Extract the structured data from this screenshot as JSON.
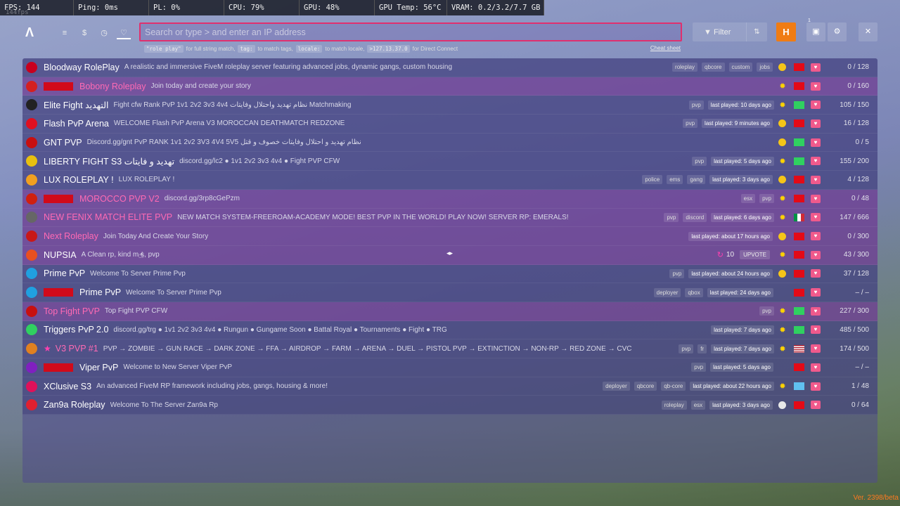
{
  "stats": [
    {
      "label": "FPS: 144"
    },
    {
      "label": "Ping: 0ms"
    },
    {
      "label": "PL: 0%"
    },
    {
      "label": "CPU: 79%"
    },
    {
      "label": "GPU: 48%"
    },
    {
      "label": "GPU Temp: 56°C"
    },
    {
      "label": "VRAM: 0.2/3.2/7.7 GB"
    }
  ],
  "fps_ghost": "144fps",
  "nav": {
    "logo": "Λ",
    "icons": [
      "list-icon",
      "dollar-icon",
      "history-icon",
      "heart-icon"
    ],
    "glyphs": [
      "≡",
      "$",
      "◷",
      "♡"
    ]
  },
  "search": {
    "placeholder": "Search or type > and enter an IP address"
  },
  "hint": {
    "code1": "\"role play\"",
    "t1": "for full string match,",
    "code2": "tag:",
    "t2": "to match tags,",
    "code3": "locale:",
    "t3": "to match locale,",
    "code4": ">127.13.37.0",
    "t4": "for Direct Connect",
    "cheat": "Cheat sheet"
  },
  "toolbar": {
    "filter_label": "Filter",
    "user_initial": "H",
    "notif_count": "1"
  },
  "servers": [
    {
      "name": "Bloodway RolePlay",
      "desc": "A realistic and immersive FiveM roleplay server featuring advanced jobs, dynamic gangs, custom housing",
      "tags": [
        "roleplay",
        "qbcore",
        "custom",
        "jobs"
      ],
      "last": "",
      "players": "0 / 128",
      "icon_color": "#c8001e",
      "red_tag": false,
      "pink": false,
      "boost": "y",
      "flag": "red",
      "alt": false
    },
    {
      "name": "Bobony Roleplay",
      "desc": "Join today and create your story",
      "tags": [],
      "last": "",
      "players": "0 / 160",
      "icon_color": "#d42020",
      "red_tag": true,
      "pink": true,
      "boost": "sun",
      "flag": "red",
      "alt": true
    },
    {
      "name": "Elite Fight التهديد",
      "desc": "Fight cfw Rank PvP 1v1 2v2 3v3 4v4 نظام تهديد واحتلال وفايتات Matchmaking",
      "tags": [
        "pvp"
      ],
      "last": "last played: 10 days ago",
      "players": "105 / 150",
      "icon_color": "#222",
      "red_tag": false,
      "pink": false,
      "boost": "sun",
      "flag": "green",
      "alt": false
    },
    {
      "name": "Flash PvP Arena",
      "desc": "WELCOME Flash PvP Arena V3 MOROCCAN DEATHMATCH REDZONE",
      "tags": [
        "pvp"
      ],
      "last": "last played: 9 minutes ago",
      "players": "16 / 128",
      "icon_color": "#e01020",
      "red_tag": false,
      "pink": false,
      "boost": "y",
      "flag": "red",
      "alt": false
    },
    {
      "name": "GNT PVP",
      "desc": "Discord.gg/gnt PvP RANK 1v1 2v2 3V3 4V4 5V5 نظام تهديد و احتلال وفايتات خصوف و قتل",
      "tags": [],
      "last": "",
      "players": "0 / 5",
      "icon_color": "#c81010",
      "red_tag": false,
      "pink": false,
      "boost": "y",
      "flag": "green",
      "alt": false
    },
    {
      "name": "LIBERTY FIGHT S3 تهديد و فايتات",
      "desc": "discord.gg/lc2 ● 1v1 2v2 3v3 4v4 ● Fight PVP CFW",
      "tags": [
        "pvp"
      ],
      "last": "last played: 5 days ago",
      "players": "155 / 200",
      "icon_color": "#e8c010",
      "red_tag": false,
      "pink": false,
      "boost": "sun",
      "flag": "green",
      "alt": false
    },
    {
      "name": "LUX ROLEPLAY !",
      "desc": "LUX ROLEPLAY !",
      "tags": [
        "police",
        "ems",
        "gang"
      ],
      "last": "last played: 3 days ago",
      "players": "4 / 128",
      "icon_color": "#f0a020",
      "red_tag": false,
      "pink": false,
      "boost": "y",
      "flag": "red",
      "alt": false
    },
    {
      "name": "MOROCCO PVP V2",
      "desc": "discord.gg/3rp8cGePzm",
      "tags": [
        "esx",
        "pvp"
      ],
      "last": "",
      "players": "0 / 48",
      "icon_color": "#d02010",
      "red_tag": true,
      "pink": true,
      "boost": "sun",
      "flag": "red",
      "alt": true
    },
    {
      "name": "NEW FENIX MATCH ELITE PVP",
      "desc": "NEW MATCH SYSTEM-FREEROAM-ACADEMY MODE! BEST PVP IN THE WORLD! PLAY NOW! SERVER RP: EMERALS!",
      "tags": [
        "pvp",
        "discord"
      ],
      "last": "last played: 6 days ago",
      "players": "147 / 666",
      "icon_color": "#666",
      "red_tag": false,
      "pink": true,
      "boost": "sun",
      "flag": "italy",
      "alt": true
    },
    {
      "name": "Next Roleplay",
      "desc": "Join Today And Create Your Story",
      "tags": [],
      "last": "last played: about 17 hours ago",
      "players": "0 / 300",
      "icon_color": "#c81818",
      "red_tag": false,
      "pink": true,
      "boost": "y",
      "flag": "red",
      "alt": true
    },
    {
      "name": "NUPSIA",
      "desc": "A Clean rp, kind m  s, pvp",
      "tags": [],
      "last": "",
      "players": "43 / 300",
      "icon_color": "#e85020",
      "red_tag": false,
      "pink": false,
      "boost": "sun",
      "flag": "red",
      "alt": true,
      "upvote": {
        "count": "10",
        "label": "UPVOTE"
      }
    },
    {
      "name": "Prime PvP",
      "desc": "Welcome To Server Prime Pvp",
      "tags": [
        "pvp"
      ],
      "last": "last played: about 24 hours ago",
      "players": "37 / 128",
      "icon_color": "#20a0e0",
      "red_tag": false,
      "pink": false,
      "boost": "y",
      "flag": "red",
      "alt": false
    },
    {
      "name": "Prime PvP",
      "desc": "Welcome To Server Prime Pvp",
      "tags": [
        "deployer",
        "qbox"
      ],
      "last": "last played: 24 days ago",
      "players": "– / –",
      "icon_color": "#20a0e0",
      "red_tag": true,
      "pink": false,
      "boost": "none",
      "flag": "red",
      "alt": false
    },
    {
      "name": "Top Fight PVP",
      "desc": "Top Fight PVP CFW",
      "tags": [
        "pvp"
      ],
      "last": "",
      "players": "227 / 300",
      "icon_color": "#c81010",
      "red_tag": false,
      "pink": true,
      "boost": "sun",
      "flag": "green",
      "alt": true
    },
    {
      "name": "Triggers PvP 2.0",
      "desc": "discord.gg/trg ● 1v1 2v2 3v3 4v4 ● Rungun ● Gungame Soon ● Battal Royal ● Tournaments ● Fight ● TRG",
      "tags": [],
      "last": "last played: 7 days ago",
      "players": "485 / 500",
      "icon_color": "#30d060",
      "red_tag": false,
      "pink": false,
      "boost": "sun",
      "flag": "green",
      "alt": false
    },
    {
      "name": "V3 PVP #1",
      "desc": "PVP → ZOMBIE → GUN RACE → DARK ZONE → FFA → AIRDROP → FARM → ARENA → DUEL → PISTOL PVP → EXTINCTION → NON-RP → RED ZONE → CVC",
      "tags": [
        "pvp",
        "fr"
      ],
      "last": "last played: 7 days ago",
      "players": "174 / 500",
      "icon_color": "#e08020",
      "red_tag": false,
      "pink": true,
      "boost": "sun",
      "flag": "us",
      "alt": false,
      "star": true
    },
    {
      "name": "Viper PvP",
      "desc": "Welcome to New Server Viper PvP",
      "tags": [
        "pvp"
      ],
      "last": "last played: 5 days ago",
      "players": "– / –",
      "icon_color": "#8020c0",
      "red_tag": true,
      "pink": false,
      "boost": "none",
      "flag": "red",
      "alt": false
    },
    {
      "name": "XClusive S3",
      "desc": "An advanced FiveM RP framework including jobs, gangs, housing & more!",
      "tags": [
        "deployer",
        "qbcore",
        "qb-core"
      ],
      "last": "last played: about 22 hours ago",
      "players": "1 / 48",
      "icon_color": "#e0105a",
      "red_tag": false,
      "pink": false,
      "boost": "sun",
      "flag": "blue",
      "alt": false
    },
    {
      "name": "Zan9a Roleplay",
      "desc": "Welcome To The Server Zan9a Rp",
      "tags": [
        "roleplay",
        "esx"
      ],
      "last": "last played: 3 days ago",
      "players": "0 / 64",
      "icon_color": "#e02030",
      "red_tag": false,
      "pink": false,
      "boost": "w",
      "flag": "red",
      "alt": false
    }
  ],
  "version": "Ver. 2398/beta",
  "colors": {
    "accent": "#e0306e",
    "user": "#f07c14",
    "fav": "#f05a8c",
    "boost": "#f5c518"
  }
}
